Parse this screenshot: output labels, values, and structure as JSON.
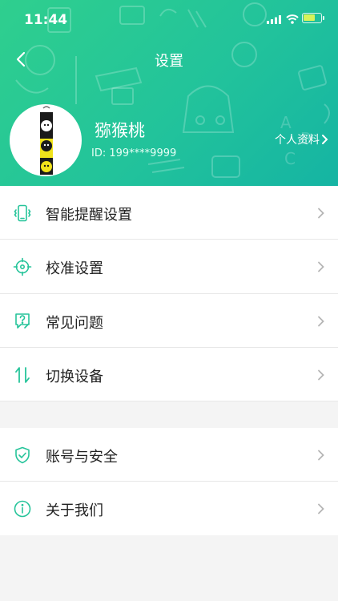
{
  "status": {
    "time": "11:44"
  },
  "nav": {
    "title": "设置"
  },
  "profile": {
    "nickname": "猕猴桃",
    "id_text": "ID: 199****9999",
    "profile_link": "个人资料"
  },
  "menu_group1": [
    {
      "label": "智能提醒设置",
      "icon": "phone-vibrate-icon"
    },
    {
      "label": "校准设置",
      "icon": "crosshair-icon"
    },
    {
      "label": "常见问题",
      "icon": "question-mark-icon"
    },
    {
      "label": "切换设备",
      "icon": "switch-arrows-icon"
    }
  ],
  "menu_group2": [
    {
      "label": "账号与安全",
      "icon": "shield-check-icon"
    },
    {
      "label": "关于我们",
      "icon": "info-icon"
    }
  ],
  "colors": {
    "accent": "#26c49a",
    "header_start": "#2fcf8e",
    "header_end": "#15b4a3"
  }
}
